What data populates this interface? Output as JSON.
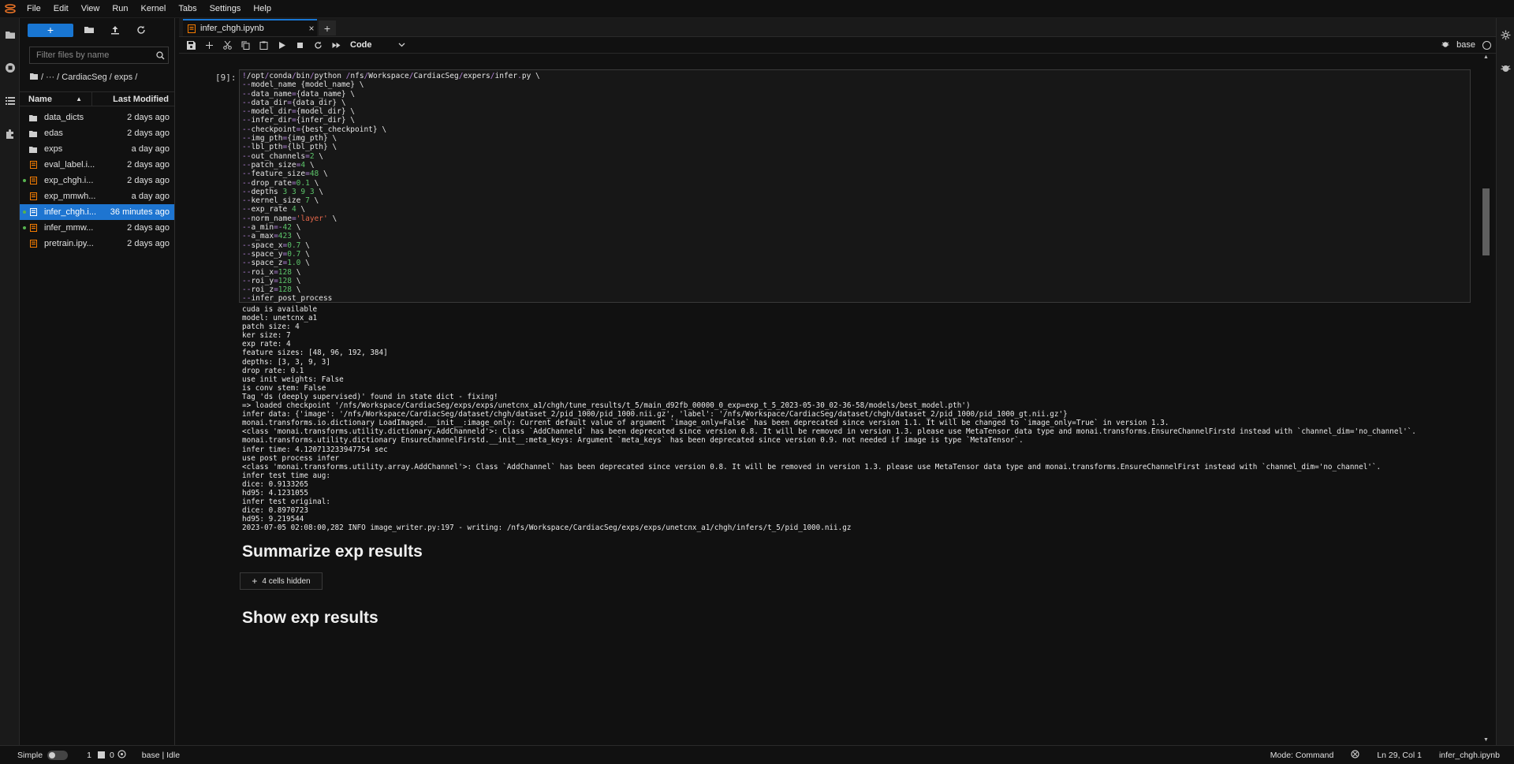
{
  "menu": [
    "File",
    "Edit",
    "View",
    "Run",
    "Kernel",
    "Tabs",
    "Settings",
    "Help"
  ],
  "filebrowser": {
    "new_label": "+",
    "search_placeholder": "Filter files by name",
    "breadcrumb": "/ ··· / CardiacSeg / exps /",
    "col_name": "Name",
    "col_modified": "Last Modified",
    "files": [
      {
        "name": "data_dicts",
        "type": "folder",
        "modified": "2 days ago",
        "running": false,
        "selected": false
      },
      {
        "name": "edas",
        "type": "folder",
        "modified": "2 days ago",
        "running": false,
        "selected": false
      },
      {
        "name": "exps",
        "type": "folder",
        "modified": "a day ago",
        "running": false,
        "selected": false
      },
      {
        "name": "eval_label.i...",
        "type": "notebook",
        "modified": "2 days ago",
        "running": false,
        "selected": false
      },
      {
        "name": "exp_chgh.i...",
        "type": "notebook",
        "modified": "2 days ago",
        "running": true,
        "selected": false
      },
      {
        "name": "exp_mmwh...",
        "type": "notebook",
        "modified": "a day ago",
        "running": false,
        "selected": false
      },
      {
        "name": "infer_chgh.i...",
        "type": "notebook",
        "modified": "36 minutes ago",
        "running": true,
        "selected": true
      },
      {
        "name": "infer_mmw...",
        "type": "notebook",
        "modified": "2 days ago",
        "running": true,
        "selected": false
      },
      {
        "name": "pretrain.ipy...",
        "type": "notebook",
        "modified": "2 days ago",
        "running": false,
        "selected": false
      }
    ]
  },
  "tab": {
    "title": "infer_chgh.ipynb",
    "close": "×",
    "add": "+"
  },
  "toolbar": {
    "cell_type": "Code",
    "kernel_name": "base"
  },
  "cell": {
    "prompt": "[9]:",
    "code_lines": [
      [
        [
          "op",
          "!"
        ],
        [
          "c",
          "/opt"
        ],
        [
          "op",
          "/"
        ],
        [
          "c",
          "conda"
        ],
        [
          "op",
          "/"
        ],
        [
          "c",
          "bin"
        ],
        [
          "op",
          "/"
        ],
        [
          "c",
          "python "
        ],
        [
          "op",
          "/"
        ],
        [
          "c",
          "nfs"
        ],
        [
          "op",
          "/"
        ],
        [
          "c",
          "Workspace"
        ],
        [
          "op",
          "/"
        ],
        [
          "c",
          "CardiacSeg"
        ],
        [
          "op",
          "/"
        ],
        [
          "c",
          "expers"
        ],
        [
          "op",
          "/"
        ],
        [
          "c",
          "infer"
        ],
        [
          "op",
          "."
        ],
        [
          "c",
          "py \\"
        ]
      ],
      [
        [
          "op",
          "--"
        ],
        [
          "c",
          "model_name {model_name} \\"
        ]
      ],
      [
        [
          "op",
          "--"
        ],
        [
          "c",
          "data_name"
        ],
        [
          "op",
          "="
        ],
        [
          "c",
          "{data_name} \\"
        ]
      ],
      [
        [
          "op",
          "--"
        ],
        [
          "c",
          "data_dir"
        ],
        [
          "op",
          "="
        ],
        [
          "c",
          "{data_dir} \\"
        ]
      ],
      [
        [
          "op",
          "--"
        ],
        [
          "c",
          "model_dir"
        ],
        [
          "op",
          "="
        ],
        [
          "c",
          "{model_dir} \\"
        ]
      ],
      [
        [
          "op",
          "--"
        ],
        [
          "c",
          "infer_dir"
        ],
        [
          "op",
          "="
        ],
        [
          "c",
          "{infer_dir} \\"
        ]
      ],
      [
        [
          "op",
          "--"
        ],
        [
          "c",
          "checkpoint"
        ],
        [
          "op",
          "="
        ],
        [
          "c",
          "{best_checkpoint} \\"
        ]
      ],
      [
        [
          "op",
          "--"
        ],
        [
          "c",
          "img_pth"
        ],
        [
          "op",
          "="
        ],
        [
          "c",
          "{img_pth} \\"
        ]
      ],
      [
        [
          "op",
          "--"
        ],
        [
          "c",
          "lbl_pth"
        ],
        [
          "op",
          "="
        ],
        [
          "c",
          "{lbl_pth} \\"
        ]
      ],
      [
        [
          "op",
          "--"
        ],
        [
          "c",
          "out_channels"
        ],
        [
          "op",
          "="
        ],
        [
          "n",
          "2"
        ],
        [
          "c",
          " \\"
        ]
      ],
      [
        [
          "op",
          "--"
        ],
        [
          "c",
          "patch_size"
        ],
        [
          "op",
          "="
        ],
        [
          "n",
          "4"
        ],
        [
          "c",
          " \\"
        ]
      ],
      [
        [
          "op",
          "--"
        ],
        [
          "c",
          "feature_size"
        ],
        [
          "op",
          "="
        ],
        [
          "n",
          "48"
        ],
        [
          "c",
          " \\"
        ]
      ],
      [
        [
          "op",
          "--"
        ],
        [
          "c",
          "drop_rate"
        ],
        [
          "op",
          "="
        ],
        [
          "n",
          "0.1"
        ],
        [
          "c",
          " \\"
        ]
      ],
      [
        [
          "op",
          "--"
        ],
        [
          "c",
          "depths "
        ],
        [
          "n",
          "3 3 9 3"
        ],
        [
          "c",
          " \\"
        ]
      ],
      [
        [
          "op",
          "--"
        ],
        [
          "c",
          "kernel_size "
        ],
        [
          "n",
          "7"
        ],
        [
          "c",
          " \\"
        ]
      ],
      [
        [
          "op",
          "--"
        ],
        [
          "c",
          "exp_rate "
        ],
        [
          "n",
          "4"
        ],
        [
          "c",
          " \\"
        ]
      ],
      [
        [
          "op",
          "--"
        ],
        [
          "c",
          "norm_name"
        ],
        [
          "op",
          "="
        ],
        [
          "s",
          "'layer'"
        ],
        [
          "c",
          " \\"
        ]
      ],
      [
        [
          "op",
          "--"
        ],
        [
          "c",
          "a_min"
        ],
        [
          "op",
          "=-"
        ],
        [
          "n",
          "42"
        ],
        [
          "c",
          " \\"
        ]
      ],
      [
        [
          "op",
          "--"
        ],
        [
          "c",
          "a_max"
        ],
        [
          "op",
          "="
        ],
        [
          "n",
          "423"
        ],
        [
          "c",
          " \\"
        ]
      ],
      [
        [
          "op",
          "--"
        ],
        [
          "c",
          "space_x"
        ],
        [
          "op",
          "="
        ],
        [
          "n",
          "0.7"
        ],
        [
          "c",
          " \\"
        ]
      ],
      [
        [
          "op",
          "--"
        ],
        [
          "c",
          "space_y"
        ],
        [
          "op",
          "="
        ],
        [
          "n",
          "0.7"
        ],
        [
          "c",
          " \\"
        ]
      ],
      [
        [
          "op",
          "--"
        ],
        [
          "c",
          "space_z"
        ],
        [
          "op",
          "="
        ],
        [
          "n",
          "1.0"
        ],
        [
          "c",
          " \\"
        ]
      ],
      [
        [
          "op",
          "--"
        ],
        [
          "c",
          "roi_x"
        ],
        [
          "op",
          "="
        ],
        [
          "n",
          "128"
        ],
        [
          "c",
          " \\"
        ]
      ],
      [
        [
          "op",
          "--"
        ],
        [
          "c",
          "roi_y"
        ],
        [
          "op",
          "="
        ],
        [
          "n",
          "128"
        ],
        [
          "c",
          " \\"
        ]
      ],
      [
        [
          "op",
          "--"
        ],
        [
          "c",
          "roi_z"
        ],
        [
          "op",
          "="
        ],
        [
          "n",
          "128"
        ],
        [
          "c",
          " \\"
        ]
      ],
      [
        [
          "op",
          "--"
        ],
        [
          "c",
          "infer_post_process"
        ]
      ]
    ],
    "output_lines": [
      "cuda is available",
      "model: unetcnx_a1",
      "patch size: 4",
      "ker size: 7",
      "exp rate: 4",
      "feature sizes: [48, 96, 192, 384]",
      "depths: [3, 3, 9, 3]",
      "drop rate: 0.1",
      "use init weights: False",
      "is conv stem: False",
      "Tag 'ds (deeply supervised)' found in state dict - fixing!",
      "=> loaded checkpoint '/nfs/Workspace/CardiacSeg/exps/exps/unetcnx_a1/chgh/tune_results/t_5/main_d92fb_00000_0_exp=exp_t_5_2023-05-30_02-36-58/models/best_model.pth')",
      "infer data: {'image': '/nfs/Workspace/CardiacSeg/dataset/chgh/dataset_2/pid_1000/pid_1000.nii.gz', 'label': '/nfs/Workspace/CardiacSeg/dataset/chgh/dataset_2/pid_1000/pid_1000_gt.nii.gz'}",
      "monai.transforms.io.dictionary LoadImaged.__init__:image_only: Current default value of argument `image_only=False` has been deprecated since version 1.1. It will be changed to `image_only=True` in version 1.3.",
      "<class 'monai.transforms.utility.dictionary.AddChanneld'>: Class `AddChanneld` has been deprecated since version 0.8. It will be removed in version 1.3. please use MetaTensor data type and monai.transforms.EnsureChannelFirstd instead with `channel_dim='no_channel'`.",
      "monai.transforms.utility.dictionary EnsureChannelFirstd.__init__:meta_keys: Argument `meta_keys` has been deprecated since version 0.9. not needed if image is type `MetaTensor`.",
      "infer time: 4.120713233947754 sec",
      "use post process infer",
      "<class 'monai.transforms.utility.array.AddChannel'>: Class `AddChannel` has been deprecated since version 0.8. It will be removed in version 1.3. please use MetaTensor data type and monai.transforms.EnsureChannelFirst instead with `channel_dim='no_channel'`.",
      "infer test time aug:",
      "dice: 0.9133265",
      "hd95: 4.1231055",
      "infer test original:",
      "dice: 0.8970723",
      "hd95: 9.219544",
      "2023-07-05 02:08:00,282 INFO image_writer.py:197 - writing: /nfs/Workspace/CardiacSeg/exps/exps/unetcnx_a1/chgh/infers/t_5/pid_1000.nii.gz"
    ]
  },
  "markdown": {
    "heading1": "Summarize exp results",
    "hidden_cells": "4 cells hidden",
    "heading2": "Show exp results"
  },
  "statusbar": {
    "simple": "Simple",
    "terminals": "1",
    "kernels": "0",
    "kernel_status": "base | Idle",
    "mode": "Mode: Command",
    "position": "Ln 29, Col 1",
    "filename": "infer_chgh.ipynb"
  },
  "colors": {
    "accent": "#1976d2",
    "notebook_icon": "#f57c00",
    "running_dot": "#57b34f"
  }
}
